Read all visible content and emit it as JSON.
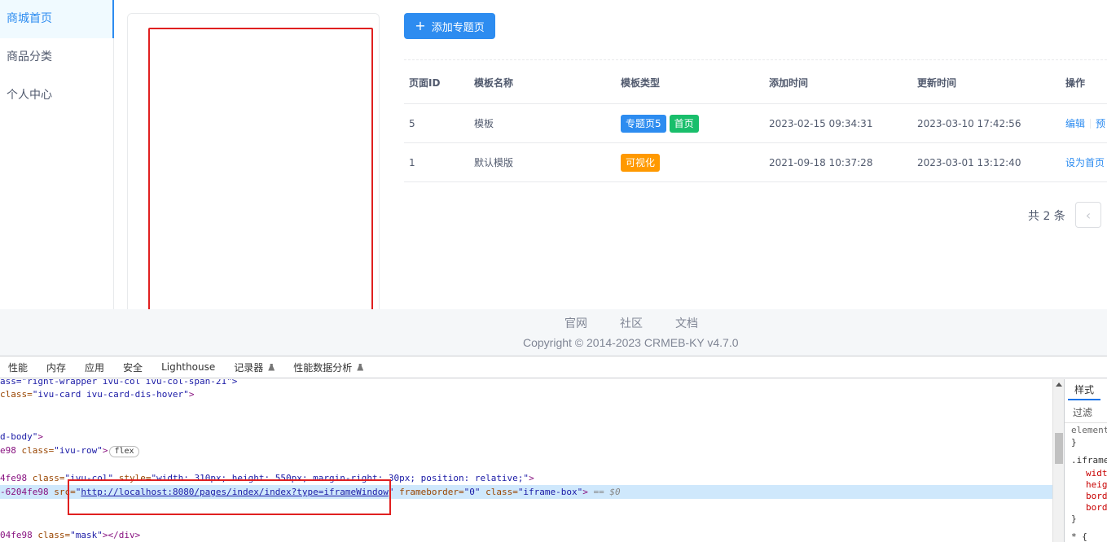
{
  "sidebar": {
    "items": [
      {
        "label": "商城首页",
        "active": true
      },
      {
        "label": "商品分类",
        "active": false
      },
      {
        "label": "个人中心",
        "active": false
      }
    ]
  },
  "toolbar": {
    "add_label": "添加专题页",
    "add_icon": "plus-icon"
  },
  "table": {
    "headers": {
      "id": "页面ID",
      "name": "模板名称",
      "type": "模板类型",
      "added": "添加时间",
      "updated": "更新时间",
      "ops": "操作"
    },
    "rows": [
      {
        "id": "5",
        "name": "模板",
        "tags": [
          "专题页5",
          "首页"
        ],
        "added": "2023-02-15 09:34:31",
        "updated": "2023-03-10 17:42:56",
        "op1": "编辑",
        "op2": "预"
      },
      {
        "id": "1",
        "name": "默认模版",
        "tags": [
          "可视化"
        ],
        "added": "2021-09-18 10:37:28",
        "updated": "2023-03-01 13:12:40",
        "op1": "设为首页"
      }
    ]
  },
  "pagination": {
    "total_label": "共 2 条",
    "prev_icon": "chevron-left-icon"
  },
  "footer": {
    "links": [
      "官网",
      "社区",
      "文档"
    ],
    "copyright": "Copyright © 2014-2023 CRMEB-KY v4.7.0"
  },
  "devtools": {
    "tabs": [
      "性能",
      "内存",
      "应用",
      "安全",
      "Lighthouse",
      "记录器",
      "性能数据分析"
    ],
    "code": {
      "l1": "ass=\"right-wrapper ivu-col ivu-col-span-21\">",
      "l2_pre": "class=",
      "l2_val": "\"ivu-card ivu-card-dis-hover\"",
      "l2_post": ">",
      "l3_val": "d-body\"",
      "l3_post": ">",
      "l4_pre": "e98 ",
      "l4_attr": "class=",
      "l4_val": "\"ivu-row\"",
      "l4_post": ">",
      "l4_pill": "flex",
      "l5_pre": "4fe98 ",
      "l5_a1": "class=",
      "l5_v1": "\"ivu-col\"",
      "l5_a2": " style=",
      "l5_v2": "\"width: 310px; height: 550px; margin-right: 30px; position: relative;\"",
      "l5_post": ">",
      "l6_pre": "-6204fe98 ",
      "l6_a1": "src=",
      "l6_q": "\"",
      "l6_url": "http://localhost:8080/pages/index/index?type=iframeWindow",
      "l6_q2": "\"",
      "l6_a2": " frameborder=",
      "l6_v2": "\"0\"",
      "l6_a3": " class=",
      "l6_v3": "\"iframe-box\"",
      "l6_post": ">",
      "l6_eq": " == $0",
      "l7_pre": "04fe98 ",
      "l7_attr": "class=",
      "l7_val": "\"mask\"",
      "l7_post": "></div>"
    },
    "styles": {
      "tab": "样式",
      "filter": "过滤",
      "lines": [
        "element",
        "}",
        ".iframe",
        "widt",
        "heig",
        "bord",
        "bord",
        "}",
        "* {"
      ]
    }
  }
}
